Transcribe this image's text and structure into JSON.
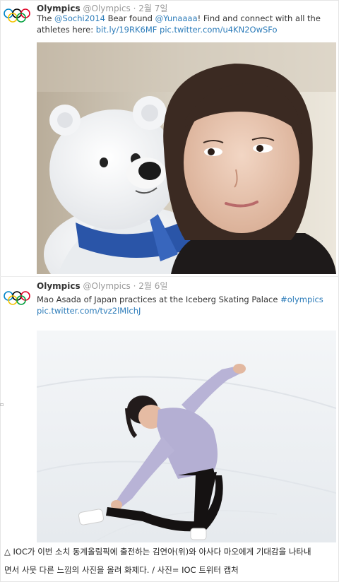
{
  "tweet1": {
    "name": "Olympics",
    "handle": "@Olympics",
    "date": "2월 7일",
    "text_1": "The ",
    "mention_sochi": "@Sochi2014",
    "text_2": " Bear found ",
    "mention_yuna": "@Yunaaaa",
    "text_3": "!  Find and connect with all the athletes here: ",
    "link_1": "bit.ly/19RK6MF",
    "link_2": "pic.twitter.com/u4KN2OwSFo"
  },
  "tweet2": {
    "name": "Olympics",
    "handle": "@Olympics",
    "date": "2월 6일",
    "text_1": "Mao Asada of Japan practices at the Iceberg Skating Palace ",
    "hashtag": "#olympics",
    "link": "pic.twitter.com/tvz2lMlchJ"
  },
  "caption": {
    "line1": "△ IOC가 이번 소치 동계올림픽에 출전하는 김연아(위)와 아사다 마오에게 기대감을 나타내",
    "line2": "면서 사뭇 다른 느낌의 사진을 올려 화제다. / 사진= IOC 트위터 캡처"
  },
  "colors": {
    "link": "#2b7bb9",
    "ring_blue": "#0085c7",
    "ring_yellow": "#f4c300",
    "ring_black": "#000000",
    "ring_green": "#009f3d",
    "ring_red": "#df0024"
  },
  "icons": {
    "logo": "olympic-rings-icon"
  }
}
